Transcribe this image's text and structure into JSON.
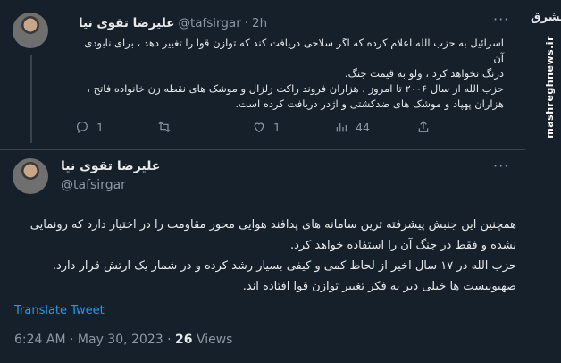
{
  "watermark": {
    "logo_text": "مشرق",
    "site": "mashreghnews.ir"
  },
  "tweet1": {
    "author_name": "علیرضا تقوی نیا",
    "handle": "@tafsirgar",
    "time_sep": "·",
    "time": "2h",
    "lines": [
      "اسرائیل به حزب الله اعلام کرده که اگر سلاحی دریافت کند که توازن قوا را تغییر دهد ، برای نابودی آن",
      "درنگ نخواهد کرد ، ولو به قیمت جنگ.",
      "حزب الله از سال ۲۰۰۶ تا امروز ، هزاران فروند راکت زلزال و موشک های نقطه زن خانواده فاتح ،",
      "هزاران پهپاد و موشک های ضدکشتی و اژدر دریافت کرده است."
    ],
    "actions": {
      "replies": "1",
      "retweets": "",
      "likes": "1",
      "views": "44"
    }
  },
  "tweet2": {
    "author_name": "علیرضا تقوی نیا",
    "handle": "@tafsirgar",
    "lines": [
      "همچنین این جنبش پیشرفته ترین سامانه های پدافند هوایی محور مقاومت را در اختیار دارد که رونمایی",
      "نشده و فقط در جنگ آن را استفاده خواهد کرد.",
      "حزب الله در ۱۷ سال اخیر از لحاظ کمی و کیفی بسیار رشد کرده و در شمار یک ارتش قرار دارد.",
      "صهیونیست ها خیلی دیر به فکر تغییر توازن قوا افتاده اند."
    ],
    "translate_label": "Translate Tweet",
    "time": "6:24 AM",
    "date": "May 30, 2023",
    "views_count": "26",
    "views_label": "Views",
    "sep": "·"
  },
  "colors": {
    "background": "#15202b",
    "accent": "#1d9bf0",
    "muted": "#8b98a5",
    "divider": "#38444d"
  }
}
